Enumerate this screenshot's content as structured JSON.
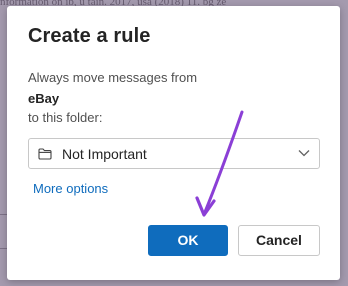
{
  "background": {
    "text": "nformation on ib, u   tain. 2017, usa (2018) 11. bg ze"
  },
  "dialog": {
    "title": "Create a rule",
    "line1": "Always move messages from",
    "sender": "eBay",
    "line3": "to this folder:",
    "folder": {
      "icon": "folder-icon",
      "selected": "Not Important"
    },
    "more_options": "More options",
    "ok_label": "OK",
    "cancel_label": "Cancel"
  },
  "colors": {
    "accent": "#0f6cbd",
    "arrow": "#8b3fd6"
  }
}
